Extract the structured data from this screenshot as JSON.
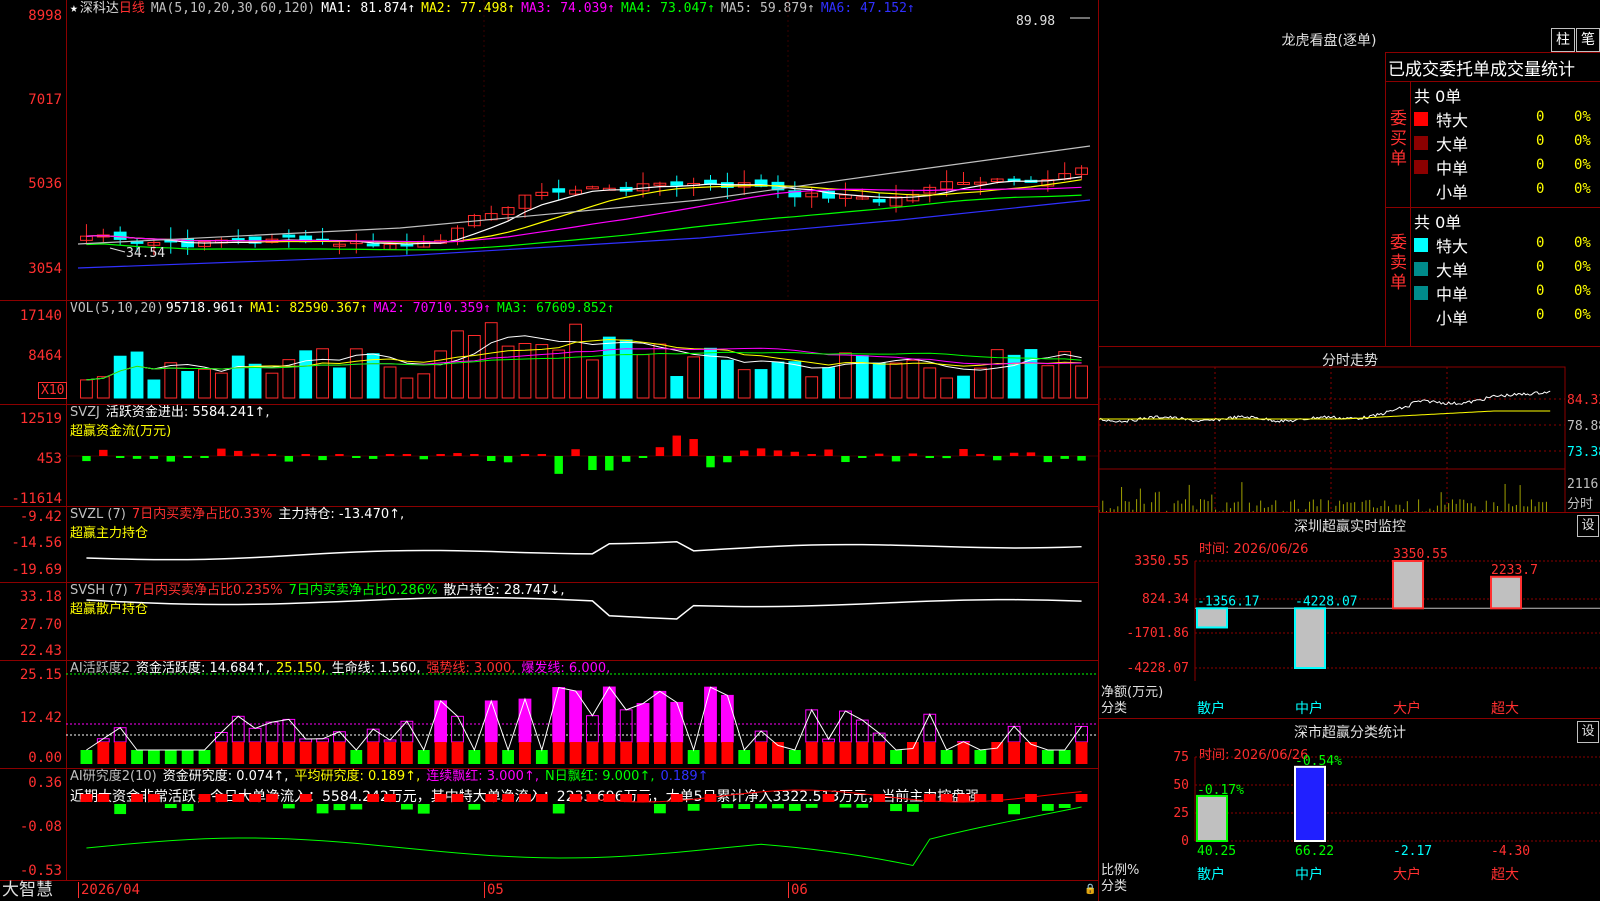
{
  "colors": {
    "up": "#ff2a2a",
    "down": "#00ffff",
    "ma1": "#ffffff",
    "ma2": "#ffff00",
    "ma3": "#ff00ff",
    "ma4": "#00ff00",
    "ma5": "#c0c0c0",
    "ma6": "#0000ff",
    "grid": "#8b0000"
  },
  "main": {
    "icon": "star-icon",
    "name": "深科达",
    "period": "日线",
    "ma_param": "MA(5,10,20,30,60,120)",
    "ma": [
      {
        "label": "MA1: 81.874↑",
        "color": "#ffffff"
      },
      {
        "label": "MA2: 77.498↑",
        "color": "#ffff00"
      },
      {
        "label": "MA3: 74.039↑",
        "color": "#ff00ff"
      },
      {
        "label": "MA4: 73.047↑",
        "color": "#00ff00"
      },
      {
        "label": "MA5: 59.879↑",
        "color": "#c0c0c0"
      },
      {
        "label": "MA6: 47.152↑",
        "color": "#3030ff"
      }
    ],
    "yticks": [
      "8998",
      "7017",
      "5036",
      "3054"
    ],
    "high_label": "89.98",
    "low_label": "34.54"
  },
  "vol": {
    "param": "VOL(5,10,20)",
    "value": "95718.961↑",
    "ma1": "MA1: 82590.367↑",
    "ma2": "MA2: 70710.359↑",
    "ma3": "MA3: 67609.852↑",
    "yticks": [
      "17140",
      "8464"
    ],
    "unit": "X10"
  },
  "svzj": {
    "param": "SVZJ",
    "text1": "活跃资金进出: 5584.241↑,",
    "sub": "超赢资金流(万元)",
    "yticks": [
      "12519",
      "453",
      "-11614"
    ]
  },
  "svzl": {
    "param": "SVZL (7)",
    "text1": "7日内买卖净占比0.33%",
    "text2": "主力持仓: -13.470↑,",
    "sub": "超赢主力持仓",
    "yticks": [
      "-9.42",
      "-14.56",
      "-19.69"
    ]
  },
  "svsh": {
    "param": "SVSH (7)",
    "text1": "7日内买卖净占比0.235%",
    "text2": "7日内买卖净占比0.286%",
    "text3": "散户持仓: 28.747↓,",
    "sub": "超赢散户持仓",
    "yticks": [
      "33.18",
      "27.70",
      "22.43"
    ]
  },
  "ai1": {
    "param": "AI活跃度2",
    "t1": "资金活跃度: 14.684↑,",
    "t2": "25.150,",
    "t3": "生命线: 1.560,",
    "t4": "强势线: 3.000,",
    "t5": "爆发线: 6.000,",
    "yticks": [
      "25.15",
      "12.42",
      "0.00"
    ]
  },
  "ai2": {
    "param": "AI研究度2(10)",
    "t1": "资金研究度: 0.074↑,",
    "t2": "平均研究度: 0.189↑,",
    "t3": "连续飘红: 3.000↑,",
    "t4": "N日飘红: 9.000↑,",
    "t5": "0.189↑",
    "msg": "近期大资金非常活跃，今日大单净流入：5584.242万元，其中特大单净流入：2233.696万元，大单5日累计净入3322.513万元，当前主力控盘强",
    "yticks": [
      "0.36",
      "-0.08",
      "-0.53"
    ]
  },
  "bottom": {
    "brand": "大智慧",
    "dates": [
      "2026/04",
      "05",
      "06"
    ]
  },
  "dragon": {
    "title": "龙虎看盘(逐单)",
    "btn1": "柱",
    "btn2": "笔",
    "header": "已成交委托单成交量统计",
    "buy": {
      "side": "委买单",
      "count": "共 0单",
      "rows": [
        {
          "label": "特大",
          "val": "0",
          "pct": "0%",
          "color": "#ff0000"
        },
        {
          "label": "大单",
          "val": "0",
          "pct": "0%",
          "color": "#8b0000"
        },
        {
          "label": "中单",
          "val": "0",
          "pct": "0%",
          "color": "#8b0000"
        },
        {
          "label": "小单",
          "val": "0",
          "pct": "0%",
          "color": "#000000"
        }
      ]
    },
    "sell": {
      "side": "委卖单",
      "count": "共 0单",
      "rows": [
        {
          "label": "特大",
          "val": "0",
          "pct": "0%",
          "color": "#00ffff"
        },
        {
          "label": "大单",
          "val": "0",
          "pct": "0%",
          "color": "#008b8b"
        },
        {
          "label": "中单",
          "val": "0",
          "pct": "0%",
          "color": "#008b8b"
        },
        {
          "label": "小单",
          "val": "0",
          "pct": "0%",
          "color": "#000000"
        }
      ]
    }
  },
  "fenshi": {
    "title": "分时走势",
    "yticks": [
      "84.33",
      "78.88",
      "73.38"
    ],
    "vol": "2116",
    "vol_unit": "分时"
  },
  "sz_monitor": {
    "title": "深圳超赢实时监控",
    "set": "设",
    "time": "时间: 2026/06/26",
    "yticks": [
      "3350.55",
      "824.34",
      "-1701.86",
      "-4228.07"
    ],
    "ylabel": "净额(万元)",
    "xlabel": "分类",
    "bars": [
      {
        "cat": "散户",
        "value": -1356.17,
        "label": "-1356.17"
      },
      {
        "cat": "中户",
        "value": -4228.07,
        "label": "-4228.07"
      },
      {
        "cat": "大户",
        "value": 3350.55,
        "label": "3350.55"
      },
      {
        "cat": "超大",
        "value": 2233.7,
        "label": "2233.7"
      }
    ]
  },
  "sz_class": {
    "title": "深市超赢分类统计",
    "set": "设",
    "time": "时间: 2026/06/26",
    "yticks": [
      "75",
      "50",
      "25",
      "0"
    ],
    "ylabel": "比例%",
    "xlabel": "分类",
    "bars": [
      {
        "cat": "散户",
        "value": 40.25,
        "label": "40.25",
        "chg": "-0.17%"
      },
      {
        "cat": "中户",
        "value": 66.22,
        "label": "66.22",
        "chg": "-0.54%"
      },
      {
        "cat": "大户",
        "value": -2.17,
        "label": "-2.17",
        "chg": ""
      },
      {
        "cat": "超大",
        "value": -4.3,
        "label": "-4.30",
        "chg": ""
      }
    ]
  }
}
